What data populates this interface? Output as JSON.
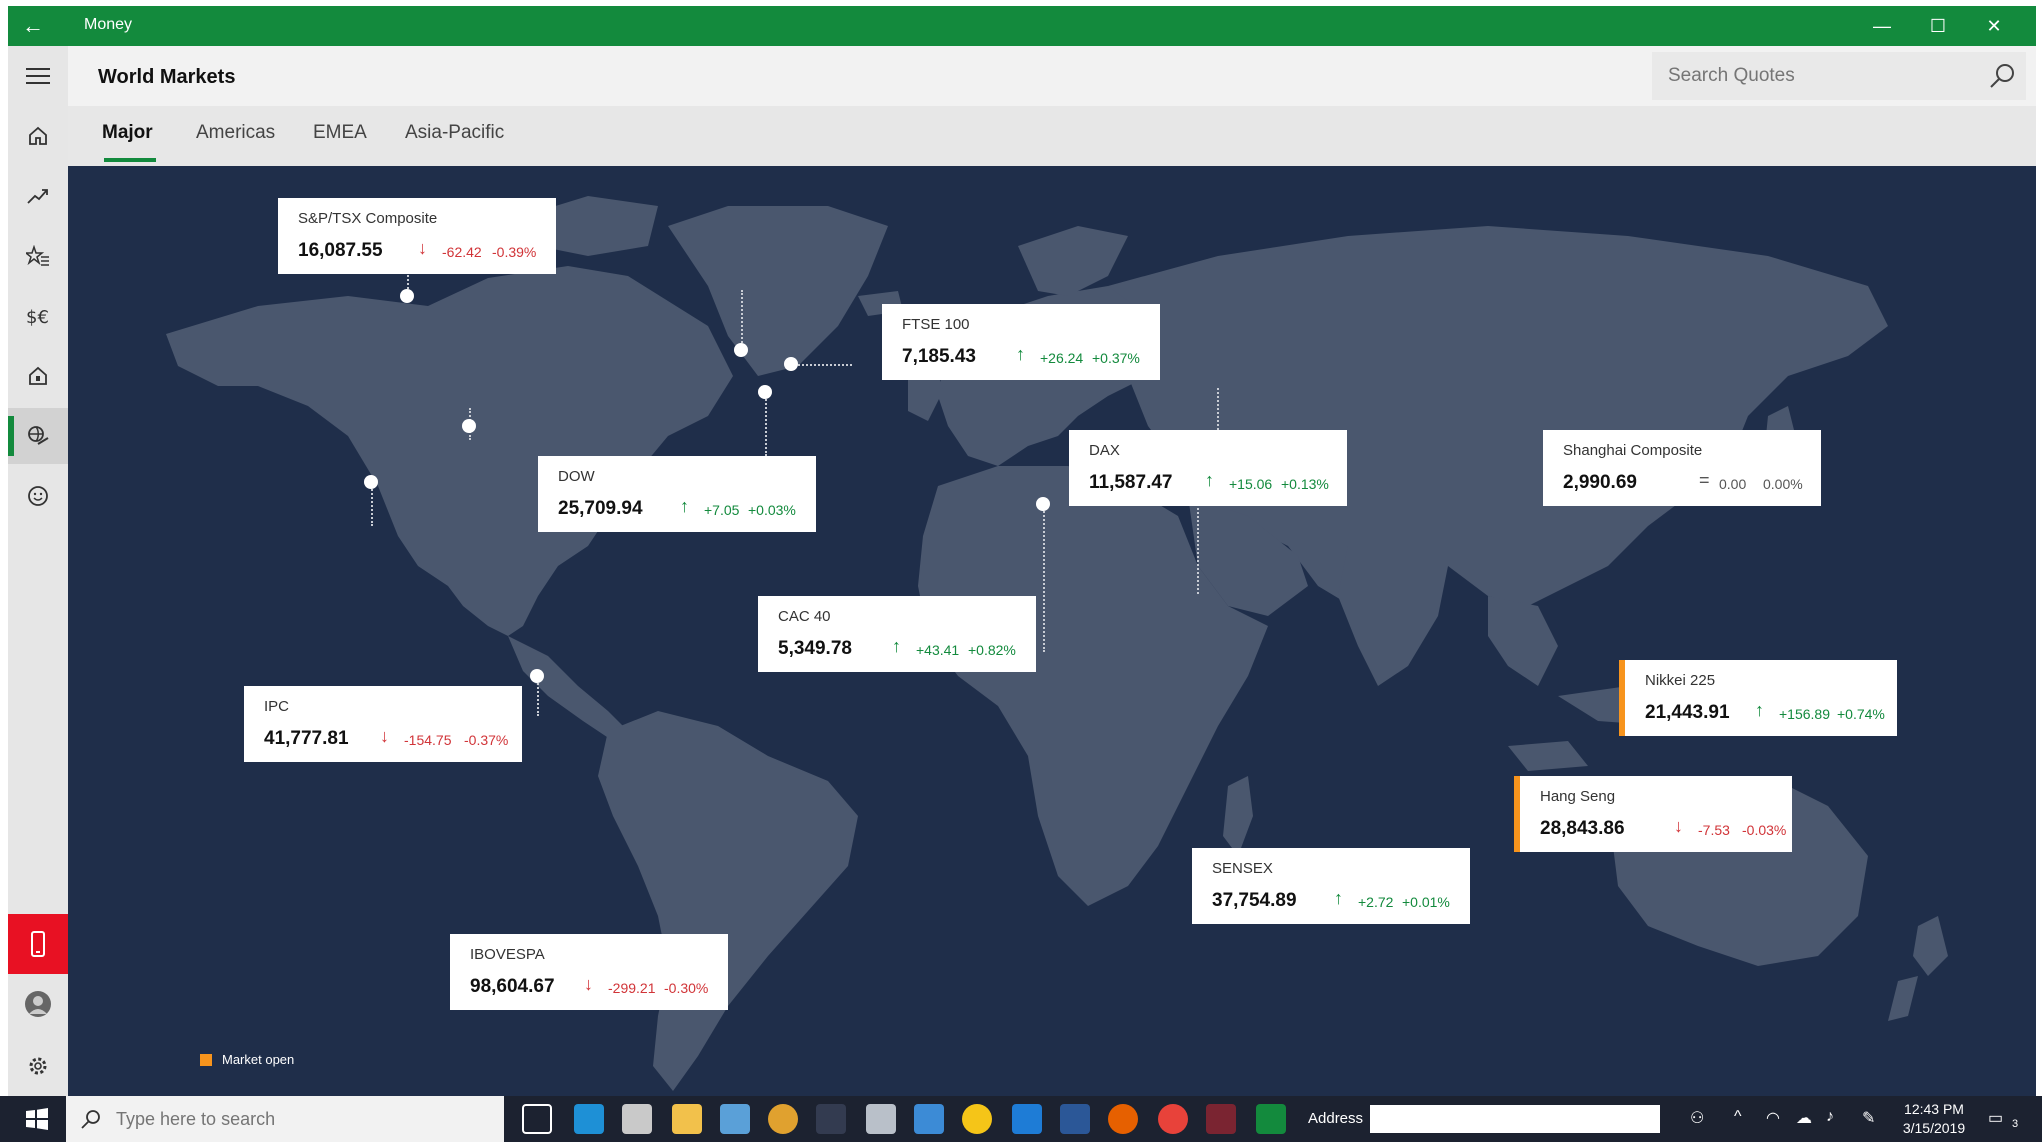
{
  "window": {
    "app_title": "Money",
    "back_label": "←",
    "minimize_label": "—",
    "maximize_label": "☐",
    "close_label": "✕"
  },
  "header": {
    "title": "World Markets",
    "search_placeholder": "Search Quotes"
  },
  "tabs": [
    {
      "label": "Major",
      "active": true
    },
    {
      "label": "Americas",
      "active": false
    },
    {
      "label": "EMEA",
      "active": false
    },
    {
      "label": "Asia-Pacific",
      "active": false
    }
  ],
  "nav": [
    {
      "icon": "menu-icon"
    },
    {
      "icon": "home-icon"
    },
    {
      "icon": "trend-icon"
    },
    {
      "icon": "watchlist-icon"
    },
    {
      "icon": "currency-icon"
    },
    {
      "icon": "mortgage-icon"
    },
    {
      "icon": "world-markets-icon",
      "active": true
    },
    {
      "icon": "feedback-icon"
    },
    {
      "icon": "phone-icon"
    },
    {
      "icon": "account-icon"
    },
    {
      "icon": "settings-icon"
    }
  ],
  "markets": [
    {
      "id": "sptsx",
      "name": "S&P/TSX Composite",
      "price": "16,087.55",
      "change": "-62.42",
      "percent": "-0.39%",
      "direction": "down",
      "open": false
    },
    {
      "id": "ftse",
      "name": "FTSE 100",
      "price": "7,185.43",
      "change": "+26.24",
      "percent": "+0.37%",
      "direction": "up",
      "open": false
    },
    {
      "id": "dax",
      "name": "DAX",
      "price": "11,587.47",
      "change": "+15.06",
      "percent": "+0.13%",
      "direction": "up",
      "open": false
    },
    {
      "id": "shanghai",
      "name": "Shanghai Composite",
      "price": "2,990.69",
      "change": "0.00",
      "percent": "0.00%",
      "direction": "flat",
      "open": false
    },
    {
      "id": "dow",
      "name": "DOW",
      "price": "25,709.94",
      "change": "+7.05",
      "percent": "+0.03%",
      "direction": "up",
      "open": false
    },
    {
      "id": "cac",
      "name": "CAC 40",
      "price": "5,349.78",
      "change": "+43.41",
      "percent": "+0.82%",
      "direction": "up",
      "open": false
    },
    {
      "id": "nikkei",
      "name": "Nikkei 225",
      "price": "21,443.91",
      "change": "+156.89",
      "percent": "+0.74%",
      "direction": "up",
      "open": true
    },
    {
      "id": "ipc",
      "name": "IPC",
      "price": "41,777.81",
      "change": "-154.75",
      "percent": "-0.37%",
      "direction": "down",
      "open": false
    },
    {
      "id": "hangseng",
      "name": "Hang Seng",
      "price": "28,843.86",
      "change": "-7.53",
      "percent": "-0.03%",
      "direction": "down",
      "open": true
    },
    {
      "id": "sensex",
      "name": "SENSEX",
      "price": "37,754.89",
      "change": "+2.72",
      "percent": "+0.01%",
      "direction": "up",
      "open": false
    },
    {
      "id": "ibovespa",
      "name": "IBOVESPA",
      "price": "98,604.67",
      "change": "-299.21",
      "percent": "-0.30%",
      "direction": "down",
      "open": false
    }
  ],
  "legend": {
    "label": "Market open",
    "color": "#f7941d"
  },
  "colors": {
    "accent": "#138a3d",
    "map_background": "#1f2e4a",
    "land": "#4a576e",
    "up": "#138a3d",
    "down": "#d13438"
  },
  "taskbar": {
    "search_placeholder": "Type here to search",
    "address_label": "Address",
    "time": "12:43 PM",
    "date": "3/15/2019",
    "notification_count": "3"
  }
}
